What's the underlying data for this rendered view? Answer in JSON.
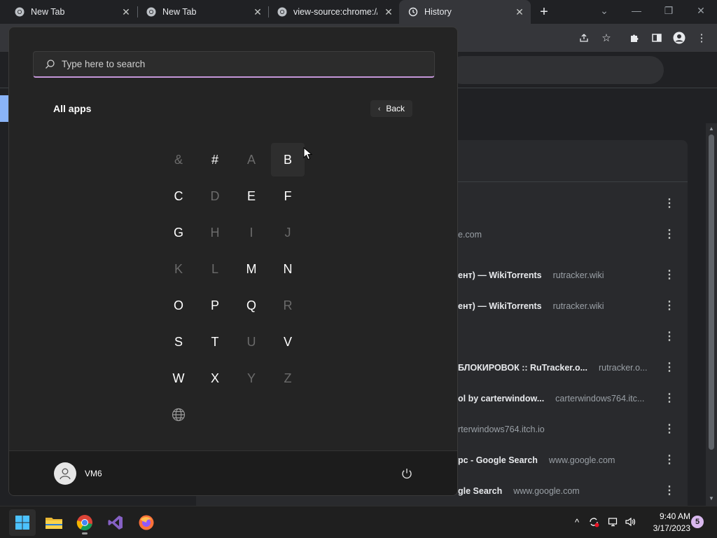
{
  "tabs": [
    {
      "label": "New Tab",
      "icon": "chrome-icon"
    },
    {
      "label": "New Tab",
      "icon": "chrome-icon"
    },
    {
      "label": "view-source:chrome://",
      "icon": "chrome-icon"
    },
    {
      "label": "History",
      "icon": "history-icon"
    }
  ],
  "history": {
    "rows": [
      {
        "title": "",
        "domain": ""
      },
      {
        "title": "",
        "domain": "e.com"
      },
      {
        "title": "ент) — WikiTorrents",
        "domain": "rutracker.wiki"
      },
      {
        "title": "ент) — WikiTorrents",
        "domain": "rutracker.wiki"
      },
      {
        "title": "",
        "domain": ""
      },
      {
        "title": "БЛОКИРОВОК :: RuTracker.o...",
        "domain": "rutracker.o..."
      },
      {
        "title": "ol by carterwindow...",
        "domain": "carterwindows764.itc..."
      },
      {
        "title": "",
        "domain": "rterwindows764.itch.io"
      },
      {
        "title": "рс - Google Search",
        "domain": "www.google.com"
      },
      {
        "title": "gle Search",
        "domain": "www.google.com"
      }
    ]
  },
  "start_menu": {
    "search_placeholder": "Type here to search",
    "all_apps_label": "All apps",
    "back_label": "Back",
    "letters": [
      {
        "char": "&",
        "enabled": false
      },
      {
        "char": "#",
        "enabled": true
      },
      {
        "char": "A",
        "enabled": false
      },
      {
        "char": "B",
        "enabled": true,
        "hover": true
      },
      {
        "char": "C",
        "enabled": true
      },
      {
        "char": "D",
        "enabled": false
      },
      {
        "char": "E",
        "enabled": true
      },
      {
        "char": "F",
        "enabled": true
      },
      {
        "char": "G",
        "enabled": true
      },
      {
        "char": "H",
        "enabled": false
      },
      {
        "char": "I",
        "enabled": false
      },
      {
        "char": "J",
        "enabled": false
      },
      {
        "char": "K",
        "enabled": false
      },
      {
        "char": "L",
        "enabled": false
      },
      {
        "char": "M",
        "enabled": true
      },
      {
        "char": "N",
        "enabled": true
      },
      {
        "char": "O",
        "enabled": true
      },
      {
        "char": "P",
        "enabled": true
      },
      {
        "char": "Q",
        "enabled": true
      },
      {
        "char": "R",
        "enabled": false
      },
      {
        "char": "S",
        "enabled": true
      },
      {
        "char": "T",
        "enabled": true
      },
      {
        "char": "U",
        "enabled": false
      },
      {
        "char": "V",
        "enabled": true
      },
      {
        "char": "W",
        "enabled": true
      },
      {
        "char": "X",
        "enabled": true
      },
      {
        "char": "Y",
        "enabled": false
      },
      {
        "char": "Z",
        "enabled": false
      }
    ],
    "globe_icon": "globe-icon",
    "user_name": "VM6",
    "power_icon": "power-icon"
  },
  "taskbar": {
    "apps": [
      "start-icon",
      "file-explorer-icon",
      "chrome-icon",
      "visual-studio-icon",
      "firefox-icon"
    ],
    "time": "9:40 AM",
    "date": "3/17/2023",
    "notification_count": "5"
  },
  "colors": {
    "accent": "#c597d9",
    "menu_bg": "#242424",
    "dim_letter": "#6b6b6b",
    "link_blue": "#8ab4f8"
  }
}
